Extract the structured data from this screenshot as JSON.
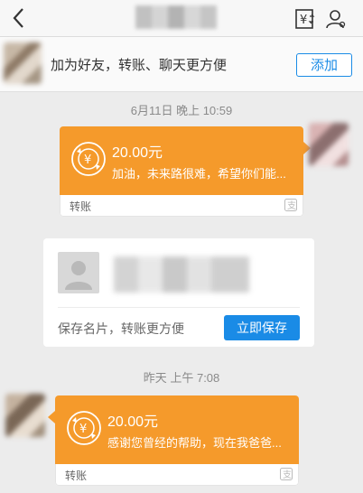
{
  "header": {
    "back_icon": "chevron-left-icon",
    "title": "",
    "transfer_icon": "yuan-transfer-icon",
    "profile_icon": "user-settings-icon"
  },
  "banner": {
    "text": "加为好友，转账、聊天更方便",
    "add_label": "添加"
  },
  "messages": [
    {
      "timestamp": "6月11日 晚上 10:59",
      "amount": "20.00元",
      "message": "加油，未来路很难，希望你们能...",
      "label": "转账",
      "direction": "outgoing"
    },
    {
      "timestamp": "昨天 上午 7:08",
      "amount": "20.00元",
      "message": "感谢您曾经的帮助，现在我爸爸...",
      "label": "转账",
      "direction": "incoming"
    }
  ],
  "namecard": {
    "hint": "保存名片，转账更方便",
    "save_label": "立即保存"
  },
  "colors": {
    "transfer_orange": "#f59a2b",
    "accent_blue": "#1a8be6"
  }
}
